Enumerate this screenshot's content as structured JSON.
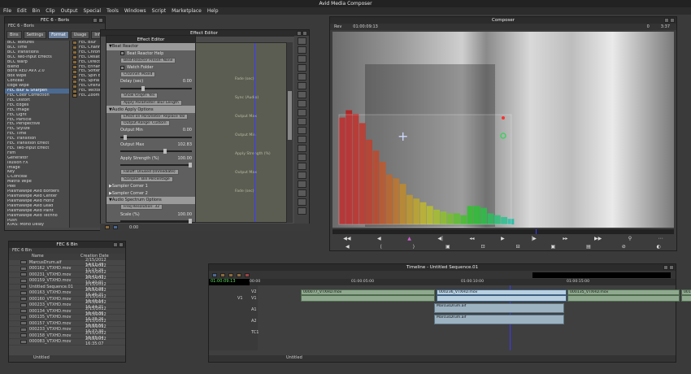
{
  "app": {
    "title": "Avid Media Composer"
  },
  "menu": [
    "File",
    "Edit",
    "Bin",
    "Clip",
    "Output",
    "Special",
    "Tools",
    "Windows",
    "Script",
    "Marketplace",
    "Help"
  ],
  "effect_bin": {
    "title": "FEC 6 - Boris",
    "tab_label": "FEC 6 - Boris",
    "tabs": [
      "Bins",
      "Settings",
      "Format",
      "Usage",
      "Info"
    ],
    "categories": [
      "BCC Textures",
      "BCC Time",
      "BCC Transitions",
      "BCC Two-Input Effects",
      "BCC Warp",
      "Blend",
      "Boris RED AVX 2.0",
      "Box Wipe",
      "Conceal",
      "Edge Wipe",
      "FEC Blur & Sharpen",
      "FEC Color Correction",
      "FEC Distort",
      "FEC Edges",
      "FEC Image",
      "FEC Light",
      "FEC Particle",
      "FEC Perspective",
      "FEC Stylize",
      "FEC Time",
      "FEC Transition",
      "FEC Transition Effect",
      "FEC Two-Input Effect",
      "Film",
      "Generator",
      "Illusion FX",
      "Image",
      "Key",
      "L-Conceal",
      "Matrix Wipe",
      "Peel",
      "PlasmaWipe Avid Borders",
      "PlasmaWipe Avid Center",
      "PlasmaWipe Avid Horiz",
      "PlasmaWipe Avid Lead",
      "PlasmaWipe Avid Paint",
      "PlasmaWipe Avid Techno",
      "Push",
      "KTAS: Mono Delay",
      "KTAS: Mono Dynamics"
    ],
    "selected_index": 10,
    "effects": [
      "FEC Blur",
      "FEC Chann",
      "FEC Chrom",
      "FEC Desatu",
      "FEC Direct",
      "FEC Enhan",
      "FEC Soften",
      "FEC Spin Bl",
      "FEC Spiral B",
      "FEC Unsharp",
      "FEC Vector E",
      "FEC Zoom B"
    ]
  },
  "effect_editor": {
    "title": "Effect Editor",
    "rows": [
      {
        "kind": "group",
        "label": "Beat Reactor"
      },
      {
        "kind": "check",
        "label": "Beat Reactor Help"
      },
      {
        "kind": "button",
        "label": "Beat Reactor Preset: None"
      },
      {
        "kind": "check",
        "label": "Watch Folder"
      },
      {
        "kind": "button",
        "label": "Channel: Mixed"
      },
      {
        "kind": "slider",
        "label": "Delay (sec)",
        "value": "0.00",
        "pos": 0.3
      },
      {
        "kind": "spacer",
        "label": ""
      },
      {
        "kind": "button",
        "label": "Show Graph: Yes"
      },
      {
        "kind": "button",
        "label": "Apply Parameter: Blur Length"
      },
      {
        "kind": "group",
        "label": "Audio Apply Options"
      },
      {
        "kind": "button",
        "label": "Effect on Parameter: Replace Val"
      },
      {
        "kind": "button",
        "label": "Output Range: Custom"
      },
      {
        "kind": "slider",
        "label": "Output Min",
        "value": "0.00",
        "pos": 0.05
      },
      {
        "kind": "spacer",
        "label": ""
      },
      {
        "kind": "slider",
        "label": "Output Max",
        "value": "102.83",
        "pos": 0.6
      },
      {
        "kind": "spacer",
        "label": ""
      },
      {
        "kind": "slider",
        "label": "Apply Strength (%)",
        "value": "100.00",
        "pos": 0.95
      },
      {
        "kind": "spacer",
        "label": ""
      },
      {
        "kind": "button",
        "label": "Falloff: Unused (Immediate)"
      },
      {
        "kind": "button",
        "label": "Sampler: Bin Percentage"
      },
      {
        "kind": "sub",
        "label": "Sampler Corner 1"
      },
      {
        "kind": "sub",
        "label": "Sampler Corner 2"
      },
      {
        "kind": "group",
        "label": "Audio Spectrum Options"
      },
      {
        "kind": "button",
        "label": "Freq Resolution: 32"
      },
      {
        "kind": "slider",
        "label": "Scale (%)",
        "value": "100.00",
        "pos": 0.95
      }
    ],
    "keyframe_labels": [
      "Fade (sec)",
      "Sync (Audio)",
      "Output Max",
      "Output Min",
      "Apply Strength (%)",
      "Output Max",
      "Fade (sec)"
    ],
    "timecode": "0:00"
  },
  "composer": {
    "title": "Composer",
    "clip_label": "Rev",
    "timecode": "01:00:09:13",
    "right_label_1": "0",
    "right_label_2": "3:37"
  },
  "bin": {
    "title": "FEC 6 Bin",
    "tab_label": "FEC 6 Bin",
    "columns": [
      "Name",
      "Creation Date"
    ],
    "rows": [
      [
        "MarcusDrum.aif",
        "2/15/2012 14:11:49"
      ],
      [
        "000162_VTXHD.mov",
        "2/15/2012 11:15:25"
      ],
      [
        "000231_VTXHD.mov",
        "2/15/2012 10:41:43"
      ],
      [
        "000159_VTXHD.mov",
        "2/15/2012 10:40:01"
      ],
      [
        "Untitled Sequence.01",
        "2/15/2012 16:52:28"
      ],
      [
        "000163_VTXHD.mov",
        "2/15/2012 16:46:21"
      ],
      [
        "000160_VTXHD.mov",
        "2/15/2012 16:46:14"
      ],
      [
        "000233_VTXHD.mov",
        "2/15/2012 16:44:21"
      ],
      [
        "000134_VTXHD.mov",
        "2/15/2012 16:40:36"
      ],
      [
        "000135_VTXHD.mov",
        "2/15/2012 16:38:26"
      ],
      [
        "000157_VTXHD.mov",
        "2/15/2012 16:38:56"
      ],
      [
        "000233_VTXHD.mov",
        "2/15/2012 16:37:30"
      ],
      [
        "000158_VTXHD.mov",
        "2/15/2012 16:35:04"
      ],
      [
        "000083_VTXHD.mov",
        "2/15/2012 16:35:07"
      ]
    ],
    "footer": "Untitled"
  },
  "timeline": {
    "title": "Timeline - Untitled Sequence.01",
    "timecode": "01:00:09:13",
    "ruler": [
      "00:00",
      "01:00:05:00",
      "01:00:10:00",
      "01:00:15:00"
    ],
    "tracks": [
      "V2",
      "V1",
      "A1",
      "A2",
      "TC1"
    ],
    "source_track": "V1",
    "video_clips": [
      "000077_VTXHD.mov",
      "000236_VTXHD.mov",
      "000135_VTXHD.mov",
      "001160_VTXHD.mov"
    ],
    "selected_clip": "000236_VTXHD.mov",
    "audio_clips": [
      "MarcusDrum.aif",
      "MarcusDrum.aif"
    ],
    "footer": "Untitled"
  },
  "colors": {
    "accent": "#4b6a92",
    "playhead": "#3a3aff"
  },
  "histogram_bars": [
    0.58,
    0.62,
    0.6,
    0.55,
    0.46,
    0.4,
    0.34,
    0.27,
    0.25,
    0.22,
    0.16,
    0.14,
    0.12,
    0.1,
    0.08,
    0.07,
    0.06,
    0.06,
    0.05,
    0.1,
    0.1,
    0.09,
    0.06,
    0.05,
    0.04,
    0.03
  ]
}
